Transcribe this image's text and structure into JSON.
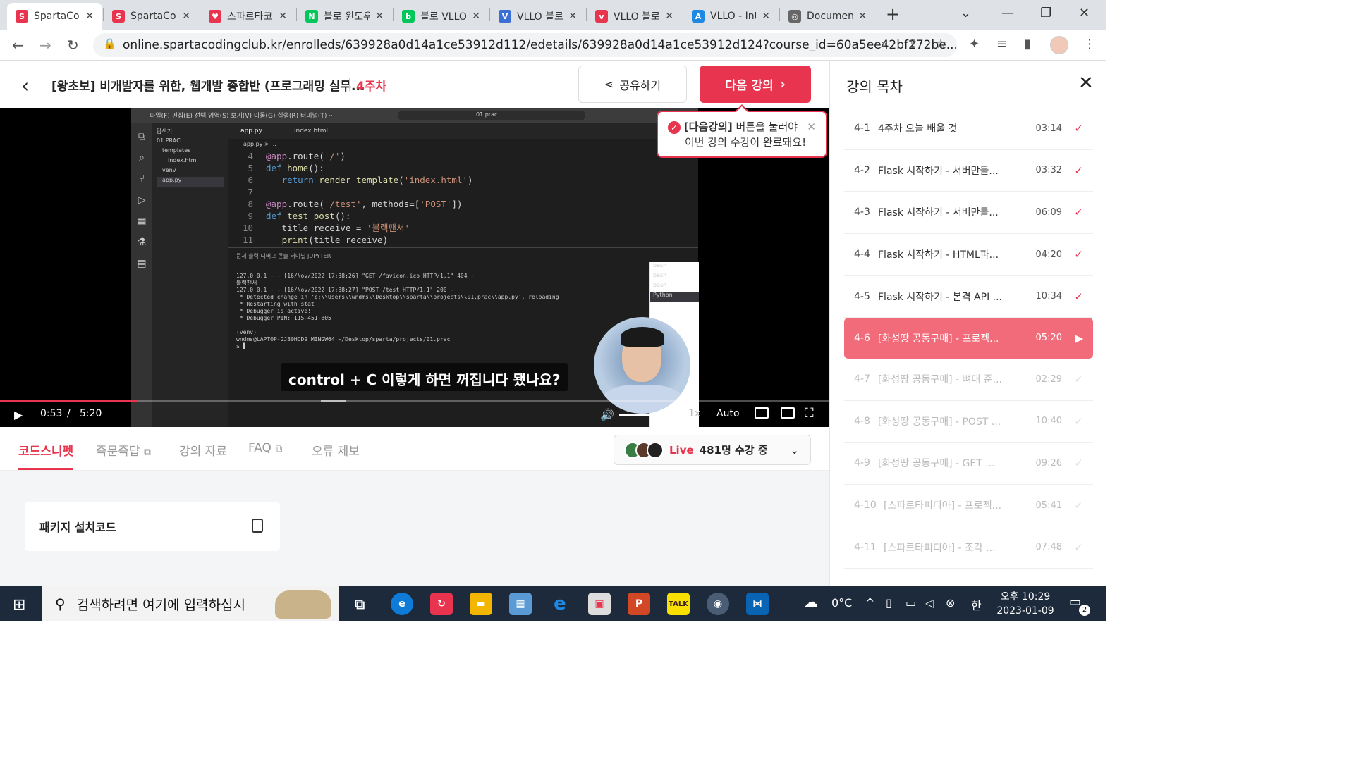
{
  "browser": {
    "tabs": [
      {
        "title": "SpartaCodingClub",
        "icon_color": "#e8344e",
        "icon_text": "S"
      },
      {
        "title": "SpartaCodingClub",
        "icon_color": "#e8344e",
        "icon_text": "S"
      },
      {
        "title": "스파르타코딩클럽",
        "icon_color": "#e8344e",
        "icon_text": "♥"
      },
      {
        "title": "블로 윈도우",
        "icon_color": "#03c75a",
        "icon_text": "N"
      },
      {
        "title": "블로 VLLO",
        "icon_color": "#03c75a",
        "icon_text": "b"
      },
      {
        "title": "VLLO 블로그",
        "icon_color": "#3b6fd4",
        "icon_text": "V"
      },
      {
        "title": "VLLO 블로그",
        "icon_color": "#e8344e",
        "icon_text": "v"
      },
      {
        "title": "VLLO - Intro",
        "icon_color": "#1e88e5",
        "icon_text": "A"
      },
      {
        "title": "Document",
        "icon_color": "#666666",
        "icon_text": "◎"
      }
    ],
    "new_tab": "+",
    "url": "online.spartacodingclub.kr/enrolleds/639928a0d14a1ce53912d112/edetails/639928a0d14a1ce53912d124?course_id=60a5ee42bf272be..."
  },
  "header": {
    "course_title": "[왕초보] 비개발자를 위한, 웹개발 종합반 (프로그래밍 실무...",
    "week": "4주차",
    "share_label": "공유하기",
    "next_label": "다음 강의"
  },
  "tooltip": {
    "highlight": "[다음강의]",
    "line1_rest": " 버튼을 눌러야",
    "line2": "이번 강의 수강이 완료돼요!"
  },
  "video": {
    "caption": "control + C 이렇게 하면 꺼집니다 됐나요?",
    "current_time": "0:53",
    "separator": "/",
    "duration": "5:20",
    "played_fraction": 0.1656,
    "speed": "1x",
    "quality": "Auto",
    "vscode": {
      "menu": "파일(F)  편집(E)  선택 영역(S)  보기(V)  이동(G)  실행(R)  터미널(T)  ···",
      "search": "01.prac",
      "explorer_title": "탐색기",
      "explorer_items": [
        "01.PRAC",
        "templates",
        "index.html",
        "venv",
        "app.py"
      ],
      "tab1": "app.py",
      "tab2": "index.html",
      "breadcrumb": "app.py > ...",
      "code_lines": [
        {
          "n": "4",
          "text": "@app.route('/')"
        },
        {
          "n": "5",
          "text": "def home():"
        },
        {
          "n": "6",
          "text": "   return render_template('index.html')"
        },
        {
          "n": "7",
          "text": ""
        },
        {
          "n": "8",
          "text": "@app.route('/test', methods=['POST'])"
        },
        {
          "n": "9",
          "text": "def test_post():"
        },
        {
          "n": "10",
          "text": "   title_receive = '블랙팬서'"
        },
        {
          "n": "11",
          "text": "   print(title_receive)"
        }
      ],
      "terminal_tabs": "문제    출력    디버그 콘솔    터미널    JUPYTER",
      "terminal": "127.0.0.1 - - [16/Nov/2022 17:38:26] \"GET /favicon.ico HTTP/1.1\" 404 -\n블랙팬서\n127.0.0.1 - - [16/Nov/2022 17:38:27] \"POST /test HTTP/1.1\" 200 -\n * Detected change in 'c:\\\\Users\\\\wndms\\\\Desktop\\\\sparta\\\\projects\\\\01.prac\\\\app.py', reloading\n * Restarting with stat\n * Debugger is active!\n * Debugger PIN: 115-451-805\n\n(venv)\nwndms@LAPTOP-GJ30HCD9 MINGW64 ~/Desktop/sparta/projects/01.prac\n$ ▌",
      "terminal_sessions": [
        "bash",
        "bash",
        "bash",
        "Python"
      ]
    }
  },
  "bottom_tabs": [
    {
      "label": "코드스니펫",
      "active": true
    },
    {
      "label": "즉문즉답",
      "external": true
    },
    {
      "label": "강의 자료"
    },
    {
      "label": "FAQ",
      "external": true
    },
    {
      "label": "오류 제보"
    }
  ],
  "live": {
    "label": "Live",
    "count_text": "481명 수강 중"
  },
  "snippet_card": {
    "title": "패키지 설치코드"
  },
  "sidebar": {
    "title": "강의 목차",
    "items": [
      {
        "num": "4-1",
        "title": "4주차 오늘 배울 것",
        "duration": "03:14",
        "state": "done"
      },
      {
        "num": "4-2",
        "title": "Flask 시작하기 - 서버만들...",
        "duration": "03:32",
        "state": "done"
      },
      {
        "num": "4-3",
        "title": "Flask 시작하기 - 서버만들...",
        "duration": "06:09",
        "state": "done"
      },
      {
        "num": "4-4",
        "title": "Flask 시작하기 - HTML파...",
        "duration": "04:20",
        "state": "done"
      },
      {
        "num": "4-5",
        "title": "Flask 시작하기 - 본격 API ...",
        "duration": "10:34",
        "state": "done"
      },
      {
        "num": "4-6",
        "title": "[화성땅 공동구매] - 프로젝...",
        "duration": "05:20",
        "state": "current"
      },
      {
        "num": "4-7",
        "title": "[화성땅 공동구매] - 뼈대 준...",
        "duration": "02:29",
        "state": "todo"
      },
      {
        "num": "4-8",
        "title": "[화성땅 공동구매] - POST ...",
        "duration": "10:40",
        "state": "todo"
      },
      {
        "num": "4-9",
        "title": "[화성땅 공동구매] - GET ...",
        "duration": "09:26",
        "state": "todo"
      },
      {
        "num": "4-10",
        "title": "[스파르타피디아] - 프로젝...",
        "duration": "05:41",
        "state": "todo"
      },
      {
        "num": "4-11",
        "title": "[스파르타피디아] - 조각 ...",
        "duration": "07:48",
        "state": "todo"
      }
    ]
  },
  "taskbar": {
    "search_placeholder": "검색하려면 여기에 입력하십시",
    "weather": "0°C",
    "ime": "한",
    "time": "오후 10:29",
    "date": "2023-01-09",
    "notification_count": "2"
  },
  "colors": {
    "accent": "#e8344e",
    "current_item": "#f26b7a"
  }
}
